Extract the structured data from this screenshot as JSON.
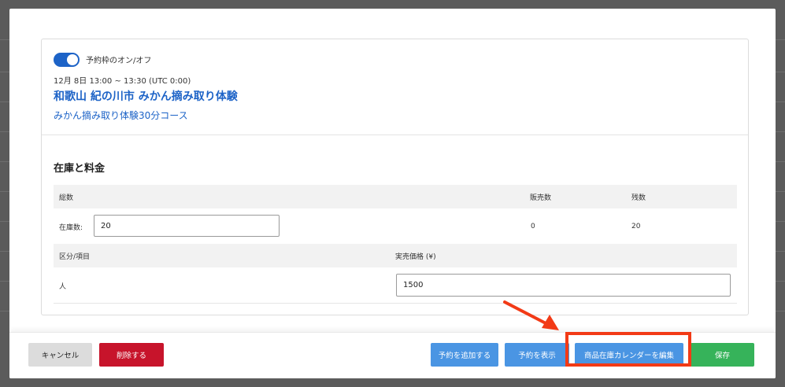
{
  "booking": {
    "toggle_label": "予約枠のオン/オフ",
    "toggle_on": true,
    "datetime": "12月 8日 13:00 ~ 13:30 (UTC 0:00)",
    "title": "和歌山 紀の川市 みかん摘み取り体験",
    "subtitle": "みかん摘み取り体験30分コース"
  },
  "inventory": {
    "section_title": "在庫と料金",
    "headers": {
      "total": "総数",
      "sold": "販売数",
      "remaining": "残数"
    },
    "stock_label": "在庫数:",
    "stock_value": "20",
    "sold_value": "0",
    "remaining_value": "20",
    "price_headers": {
      "category": "区分/項目",
      "price": "実売価格 (¥)"
    },
    "price_rows": [
      {
        "category": "人",
        "price": "1500"
      }
    ]
  },
  "footer": {
    "cancel": "キャンセル",
    "delete": "削除する",
    "add_booking": "予約を追加する",
    "show_bookings": "予約を表示",
    "edit_calendar": "商品在庫カレンダーを編集",
    "save": "保存"
  },
  "colors": {
    "accent": "#1d63c7",
    "delete": "#c7142b",
    "secondary": "#4a95e3",
    "save": "#36b35a",
    "highlight": "#f23a16"
  },
  "annotation": {
    "highlighted_button": "edit_calendar",
    "arrow_icon": "red-arrow-icon"
  }
}
